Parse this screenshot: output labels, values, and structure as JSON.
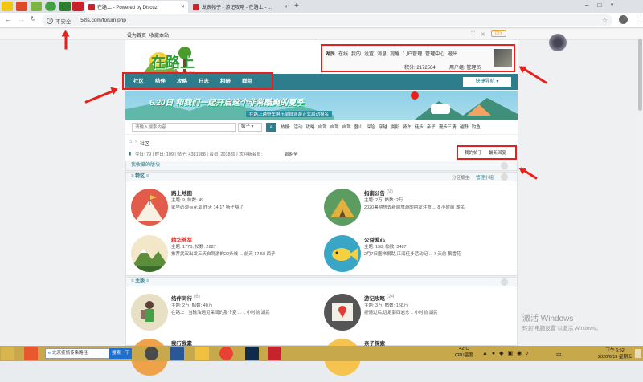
{
  "browser": {
    "tabs": [
      {
        "label": "在路上 - Powered by Discuz!"
      },
      {
        "label": "发表帖子 - 游记攻略 - 在路上 - ..."
      }
    ],
    "new_tab": "+",
    "security": "不安全",
    "url": "5zls.com/forum.php",
    "window_controls": [
      "–",
      "□",
      "×"
    ]
  },
  "topbar": {
    "set_home": "设为首页",
    "bookmark": "收藏本站",
    "diy": "DIY"
  },
  "logo": {
    "text": "在路上",
    "sub": "5zls.com"
  },
  "user": {
    "name": "湖民",
    "status": "在线",
    "links": [
      "我的",
      "设置",
      "消息",
      "提醒",
      "门户管理",
      "管理中心",
      "退出"
    ],
    "credits": "积分: 2172564",
    "group": "用户组: 管理员"
  },
  "nav": {
    "items": [
      "社区",
      "结伴",
      "攻略",
      "日志",
      "相册",
      "群组"
    ],
    "quick": "快捷导航"
  },
  "banner": {
    "title": "6.20日 和我们一起开启这个非常酷爽的夏季",
    "sub": "在路上越野车俱乐部自驾游正式启动报名"
  },
  "search": {
    "placeholder": "请输入搜索内容",
    "scope": "帖子",
    "hot_label": "热搜:",
    "hot": [
      "活动",
      "攻略",
      "自驾",
      "自驾",
      "自驾",
      "登山",
      "探险",
      "穿越",
      "摄影",
      "骑车",
      "徒步",
      "亲子",
      "漫步三清",
      "越野",
      "钓鱼"
    ]
  },
  "crumb": {
    "home": "社区"
  },
  "stats": {
    "text": "今日: 79 | 昨日: 109 | 帖子: 4381988 | 会员: 201839 | 欢迎新会员:",
    "newest": "曾昭全",
    "my_posts": "我的帖子",
    "latest": "最新回复"
  },
  "favorites": {
    "title": "我收藏的版块"
  },
  "special": {
    "title": "特区",
    "moderator_label": "分区版主:",
    "moderator": "管理小组",
    "forums": [
      {
        "name": "路上地图",
        "count": "",
        "stats": "主题: 9, 帖数: 49",
        "last": "家里必须有花草 昨天 14:17 杨子豁了"
      },
      {
        "name": "指南公告",
        "count": "(9)",
        "stats": "主题: 2万, 帖数: 2万",
        "last": "2020暑期想去新疆旅游的朋友注意 ... 8 小时前 湖民"
      },
      {
        "name": "精华荟萃",
        "count": "",
        "stats": "主题: 1773, 帖数: 2687",
        "last": "推荐武汉出发三天自驾游的20条线 ... 前天 17:58 西子"
      },
      {
        "name": "公益爱心",
        "count": "",
        "stats": "主题: 158, 帖数: 3487",
        "last": "2月7日图书捐助,江海佳多活动纪 ... 7 天前 飘雪花"
      }
    ]
  },
  "main": {
    "title": "主版",
    "forums": [
      {
        "name": "结伴同行",
        "count": "(6)",
        "stats": "主题: 2万, 帖数: 40万",
        "last": "在路上 | 当输油遇见采闻的那个夏 ... 1 小时前 湖民"
      },
      {
        "name": "游记攻略",
        "count": "(24)",
        "stats": "主题: 3万, 帖数: 158万",
        "last": "疫情过后,远足郭西岩东 1 小时前 湖民"
      },
      {
        "name": "我行我素",
        "count": "",
        "stats": "",
        "last": ""
      },
      {
        "name": "亲子探索",
        "count": "",
        "stats": "",
        "last": ""
      }
    ]
  },
  "taskbar": {
    "search_value": "北京疫情传染路径",
    "search_button": "搜索一下",
    "temp": "42°C",
    "cpu": "CPU温度",
    "lang": "中",
    "time": "下午 6:52",
    "date": "2020/6/19 星期五"
  },
  "watermark": {
    "line1": "激活 Windows",
    "line2": "转到\"电脑设置\"以激活 Windows。"
  },
  "colors": {
    "accent": "#2e7d8c",
    "highlight": "#e8201c",
    "taskbar": "#c7a84a"
  }
}
